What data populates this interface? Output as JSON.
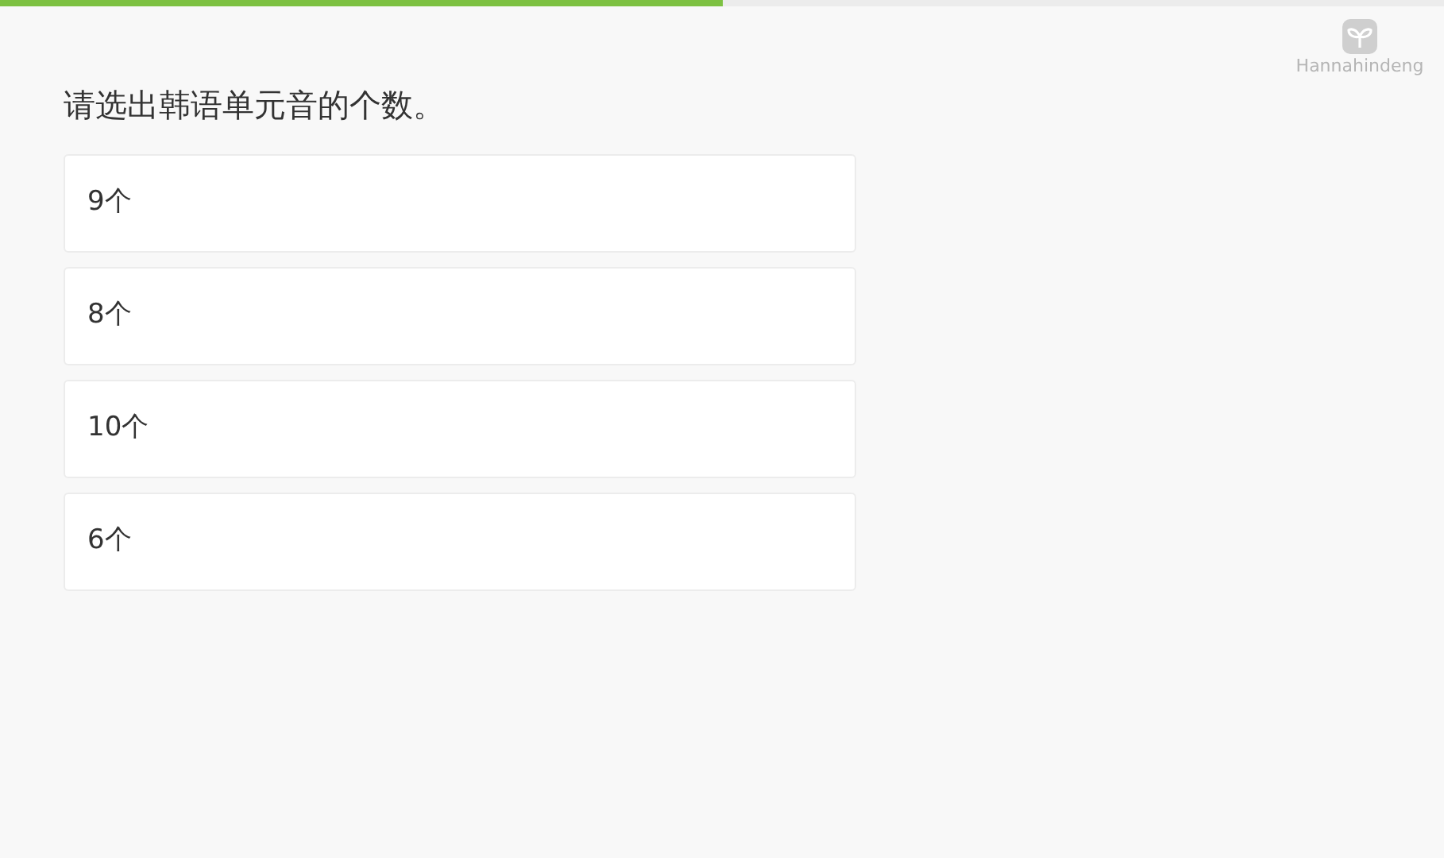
{
  "progress": {
    "level": 0.5
  },
  "brand": {
    "name": "Hannahindeng"
  },
  "question": "请选出韩语单元音的个数。",
  "options": [
    {
      "label": "9个",
      "selected": false
    },
    {
      "label": "8个",
      "selected": false
    },
    {
      "label": "10个",
      "selected": false
    },
    {
      "label": "6个",
      "selected": false
    }
  ]
}
